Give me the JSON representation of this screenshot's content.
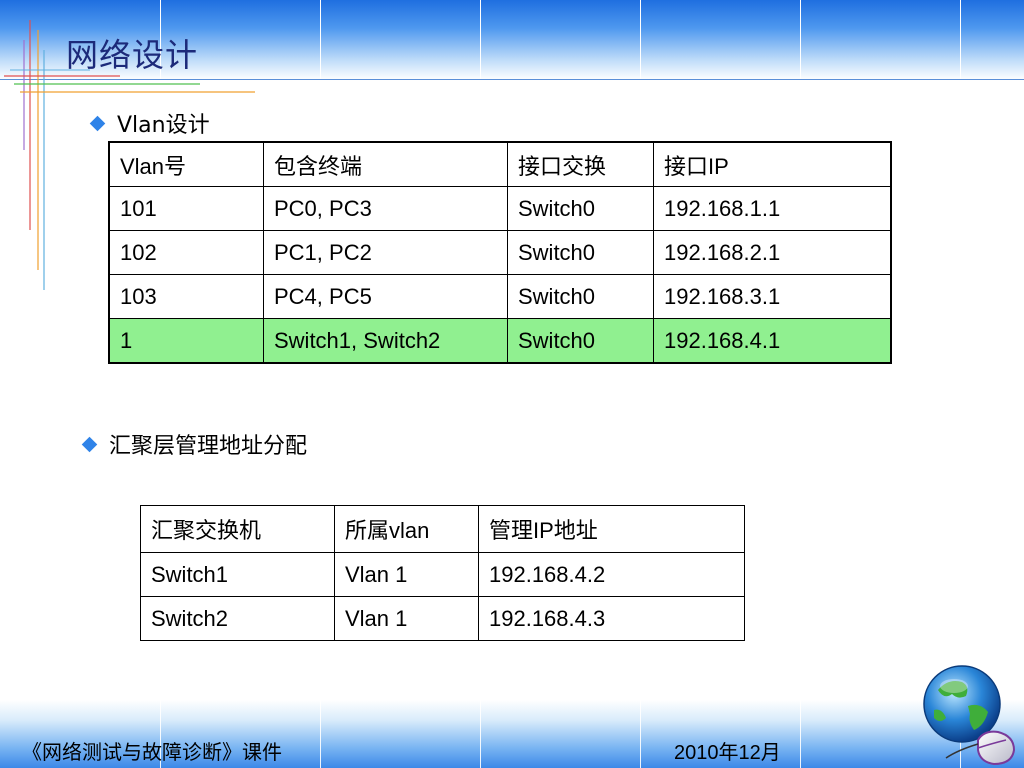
{
  "title": "网络设计",
  "section1": {
    "heading": "Vlan设计"
  },
  "vlan_table": {
    "headers": [
      "Vlan号",
      "包含终端",
      "接口交换",
      "接口IP"
    ],
    "rows": [
      [
        "101",
        "PC0, PC3",
        "Switch0",
        "192.168.1.1"
      ],
      [
        "102",
        "PC1, PC2",
        "Switch0",
        "192.168.2.1"
      ],
      [
        "103",
        "PC4, PC5",
        "Switch0",
        "192.168.3.1"
      ],
      [
        "1",
        "Switch1, Switch2",
        "Switch0",
        "192.168.4.1"
      ]
    ],
    "highlight_color": "#90f090"
  },
  "section2": {
    "heading": "汇聚层管理地址分配"
  },
  "agg_table": {
    "headers": [
      "汇聚交换机",
      "所属vlan",
      "管理IP地址"
    ],
    "rows": [
      [
        "Switch1",
        "Vlan 1",
        "192.168.4.2"
      ],
      [
        "Switch2",
        "Vlan 1",
        "192.168.4.3"
      ]
    ]
  },
  "footer": {
    "left": "《网络测试与故障诊断》课件",
    "right": "2010年12月"
  },
  "icons": {
    "bullet": "diamond-bullet-icon",
    "corner": "globe-mouse-icon"
  },
  "colors": {
    "title": "#1c2a7a",
    "bullet": "#2f83e8",
    "banner": "#3c88e8"
  }
}
